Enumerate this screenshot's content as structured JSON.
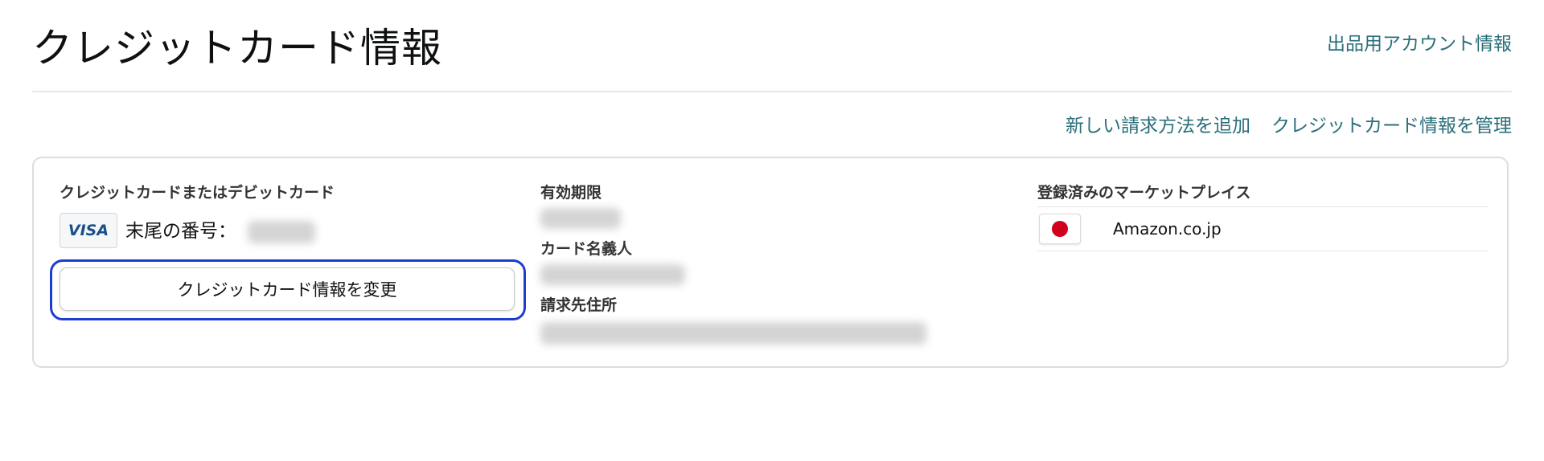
{
  "header": {
    "title": "クレジットカード情報",
    "account_link": "出品用アカウント情報"
  },
  "actions": {
    "add_payment": "新しい請求方法を追加",
    "manage_cards": "クレジットカード情報を管理"
  },
  "card": {
    "section_label": "クレジットカードまたはデビットカード",
    "brand": "VISA",
    "ending_label": "末尾の番号：",
    "change_button": "クレジットカード情報を変更"
  },
  "details": {
    "expiry_label": "有効期限",
    "holder_label": "カード名義人",
    "address_label": "請求先住所"
  },
  "marketplaces": {
    "label": "登録済みのマーケットプレイス",
    "items": [
      {
        "name": "Amazon.co.jp",
        "flag": "japan-flag-icon"
      }
    ]
  },
  "colors": {
    "link": "#2a6f7a",
    "focus_ring": "#1e3dcf",
    "flag_red": "#d0021b",
    "visa_blue": "#1a4f8a"
  }
}
